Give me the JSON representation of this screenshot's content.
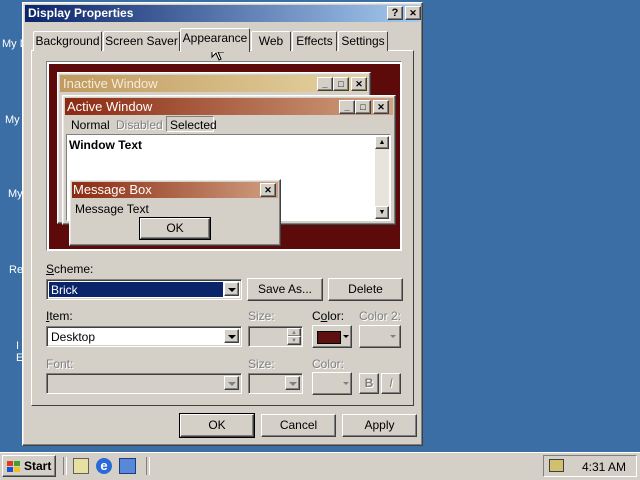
{
  "desktop": {
    "icon_labels": [
      "My D",
      "My",
      "My",
      "Re",
      "I",
      "E"
    ],
    "icon_names": [
      "my-documents",
      "my-computer",
      "my-network-places",
      "recycle-bin",
      "internet-explorer"
    ]
  },
  "dialog": {
    "title": "Display Properties",
    "help_btn": "?",
    "close_btn": "✕",
    "tabs": [
      "Background",
      "Screen Saver",
      "Appearance",
      "Web",
      "Effects",
      "Settings"
    ],
    "active_tab": "Appearance",
    "preview": {
      "inactive_title": "Inactive Window",
      "active_title": "Active Window",
      "menu": [
        "Normal",
        "Disabled",
        "Selected"
      ],
      "window_text": "Window Text",
      "msgbox_title": "Message Box",
      "msgbox_text": "Message Text",
      "msgbox_ok": "OK",
      "desktop_color": "#5c0a0a",
      "active_title_colors": [
        "#8b2a12",
        "#d0a080"
      ],
      "inactive_title_colors": [
        "#c09a60",
        "#e6d4a2"
      ]
    },
    "scheme": {
      "label": "Scheme:",
      "value": "Brick",
      "save_as": "Save As...",
      "delete": "Delete"
    },
    "item": {
      "label": "Item:",
      "value": "Desktop",
      "size_label": "Size:",
      "color_label": "Color:",
      "color2_label": "Color 2:",
      "color_value": "#5c1010"
    },
    "font": {
      "label": "Font:",
      "size_label": "Size:",
      "color_label": "Color:",
      "bold": "B",
      "italic": "I"
    },
    "buttons": {
      "ok": "OK",
      "cancel": "Cancel",
      "apply": "Apply"
    }
  },
  "taskbar": {
    "start": "Start",
    "quicklaunch": [
      "show-desktop-icon",
      "ie-icon",
      "outlook-express-icon"
    ],
    "clock": "4:31 AM"
  }
}
